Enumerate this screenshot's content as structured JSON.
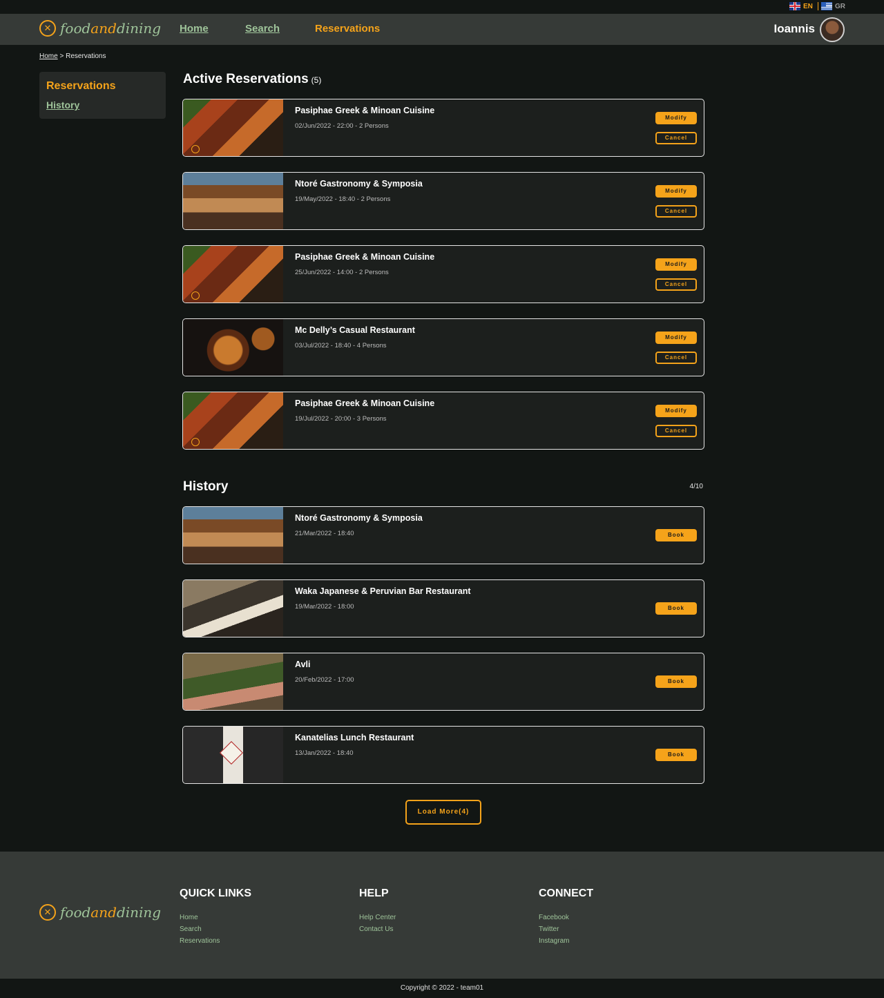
{
  "languages": [
    {
      "code": "EN",
      "active": true,
      "color": "#f5a31a"
    },
    {
      "code": "GR",
      "active": false,
      "color": "#9a9a9a"
    }
  ],
  "brand": {
    "part1": "food",
    "part2": "and",
    "part3": "dining",
    "accent": "#f5a31a",
    "primary": "#9fc49a"
  },
  "nav": {
    "home": "Home",
    "search": "Search",
    "reservations": "Reservations"
  },
  "user": {
    "name": "Ioannis"
  },
  "breadcrumb": {
    "home": "Home",
    "separator": " > ",
    "current": "Reservations"
  },
  "sidebar": {
    "title": "Reservations",
    "history": "History"
  },
  "active": {
    "title": "Active Reservations",
    "count": "(5)",
    "modify_label": "Modify",
    "cancel_label": "Cancel",
    "items": [
      {
        "name": "Pasiphae Greek & Minoan Cuisine",
        "meta": "02/Jun/2022 - 22:00 - 2 Persons",
        "image": "pasiphae"
      },
      {
        "name": "Ntoré Gastronomy & Symposia",
        "meta": "19/May/2022 - 18:40 - 2 Persons",
        "image": "ntore"
      },
      {
        "name": "Pasiphae Greek & Minoan Cuisine",
        "meta": "25/Jun/2022 - 14:00 - 2 Persons",
        "image": "pasiphae"
      },
      {
        "name": "Mc Delly’s Casual Restaurant",
        "meta": "03/Jul/2022 - 18:40 - 4 Persons",
        "image": "mcdelly"
      },
      {
        "name": "Pasiphae Greek & Minoan Cuisine",
        "meta": "19/Jul/2022 - 20:00 - 3 Persons",
        "image": "pasiphae"
      }
    ]
  },
  "history": {
    "title": "History",
    "count": "4/10",
    "book_label": "Book",
    "items": [
      {
        "name": "Ntoré Gastronomy & Symposia",
        "meta": "21/Mar/2022 - 18:40",
        "image": "ntore"
      },
      {
        "name": "Waka Japanese & Peruvian Bar Restaurant",
        "meta": "19/Mar/2022 - 18:00",
        "image": "waka"
      },
      {
        "name": "Avli",
        "meta": "20/Feb/2022 - 17:00",
        "image": "avli"
      },
      {
        "name": "Kanatelias Lunch Restaurant",
        "meta": "13/Jan/2022 - 18:40",
        "image": "kanatelias"
      }
    ],
    "load_more": "Load More(4)"
  },
  "footer": {
    "quick_links": {
      "title": "QUICK LINKS",
      "links": [
        "Home",
        "Search",
        "Reservations"
      ]
    },
    "help": {
      "title": "HELP",
      "links": [
        "Help Center",
        "Contact Us"
      ]
    },
    "connect": {
      "title": "CONNECT",
      "links": [
        "Facebook",
        "Twitter",
        "Instagram"
      ]
    },
    "copyright": "Copyright © 2022 - team01"
  }
}
